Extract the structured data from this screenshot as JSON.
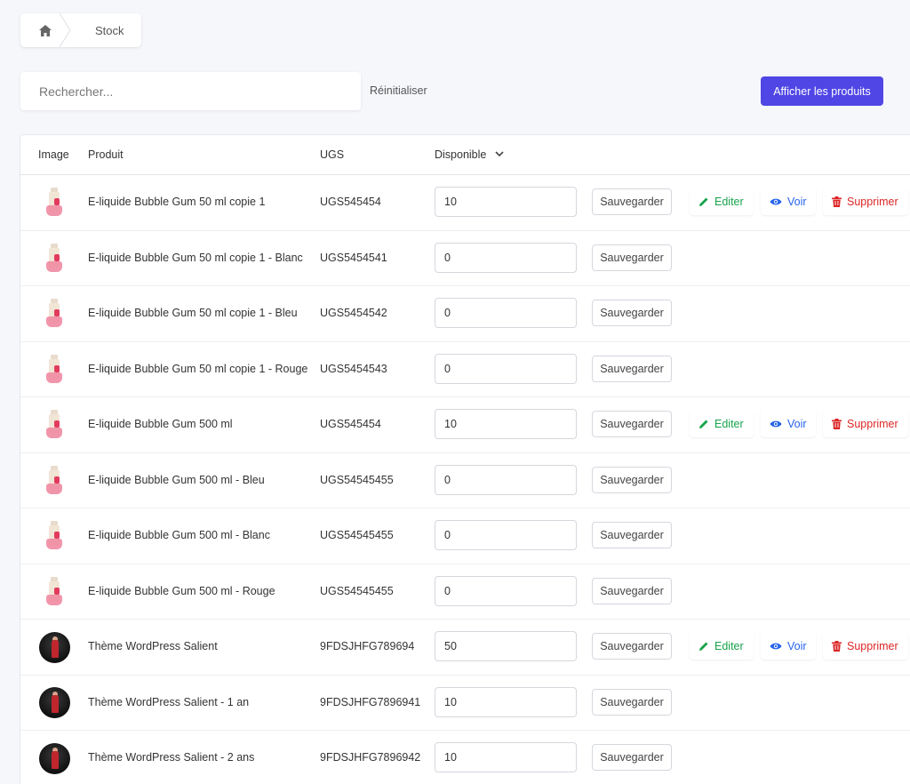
{
  "breadcrumb": {
    "home_icon": "home-icon",
    "current": "Stock"
  },
  "toolbar": {
    "search_placeholder": "Rechercher...",
    "reset_label": "Réinitialiser",
    "show_products_label": "Afficher les produits"
  },
  "colors": {
    "primary": "#4f46e5",
    "edit": "#16a34a",
    "view": "#2563eb",
    "delete": "#dc2626"
  },
  "table": {
    "headers": {
      "image": "Image",
      "product": "Produit",
      "sku": "UGS",
      "available": "Disponible"
    },
    "save_label": "Sauvegarder",
    "actions": {
      "edit": "Editer",
      "view": "Voir",
      "delete": "Supprimer"
    },
    "rows": [
      {
        "thumb": "bottle",
        "product": "E-liquide Bubble Gum 50 ml copie 1",
        "sku": "UGS545454",
        "qty": "10",
        "has_actions": true
      },
      {
        "thumb": "bottle",
        "product": "E-liquide Bubble Gum 50 ml copie 1 - Blanc",
        "sku": "UGS5454541",
        "qty": "0",
        "has_actions": false
      },
      {
        "thumb": "bottle",
        "product": "E-liquide Bubble Gum 50 ml copie 1 - Bleu",
        "sku": "UGS5454542",
        "qty": "0",
        "has_actions": false
      },
      {
        "thumb": "bottle",
        "product": "E-liquide Bubble Gum 50 ml copie 1 - Rouge",
        "sku": "UGS5454543",
        "qty": "0",
        "has_actions": false
      },
      {
        "thumb": "bottle",
        "product": "E-liquide Bubble Gum 500 ml",
        "sku": "UGS545454",
        "qty": "10",
        "has_actions": true
      },
      {
        "thumb": "bottle",
        "product": "E-liquide Bubble Gum 500 ml - Bleu",
        "sku": "UGS54545455",
        "qty": "0",
        "has_actions": false
      },
      {
        "thumb": "bottle",
        "product": "E-liquide Bubble Gum 500 ml - Blanc",
        "sku": "UGS54545455",
        "qty": "0",
        "has_actions": false
      },
      {
        "thumb": "bottle",
        "product": "E-liquide Bubble Gum 500 ml - Rouge",
        "sku": "UGS54545455",
        "qty": "0",
        "has_actions": false
      },
      {
        "thumb": "avatar",
        "product": "Thème WordPress Salient",
        "sku": "9FDSJHFG789694",
        "qty": "50",
        "has_actions": true
      },
      {
        "thumb": "avatar",
        "product": "Thème WordPress Salient - 1 an",
        "sku": "9FDSJHFG7896941",
        "qty": "10",
        "has_actions": false
      },
      {
        "thumb": "avatar",
        "product": "Thème WordPress Salient - 2 ans",
        "sku": "9FDSJHFG7896942",
        "qty": "10",
        "has_actions": false
      }
    ]
  }
}
